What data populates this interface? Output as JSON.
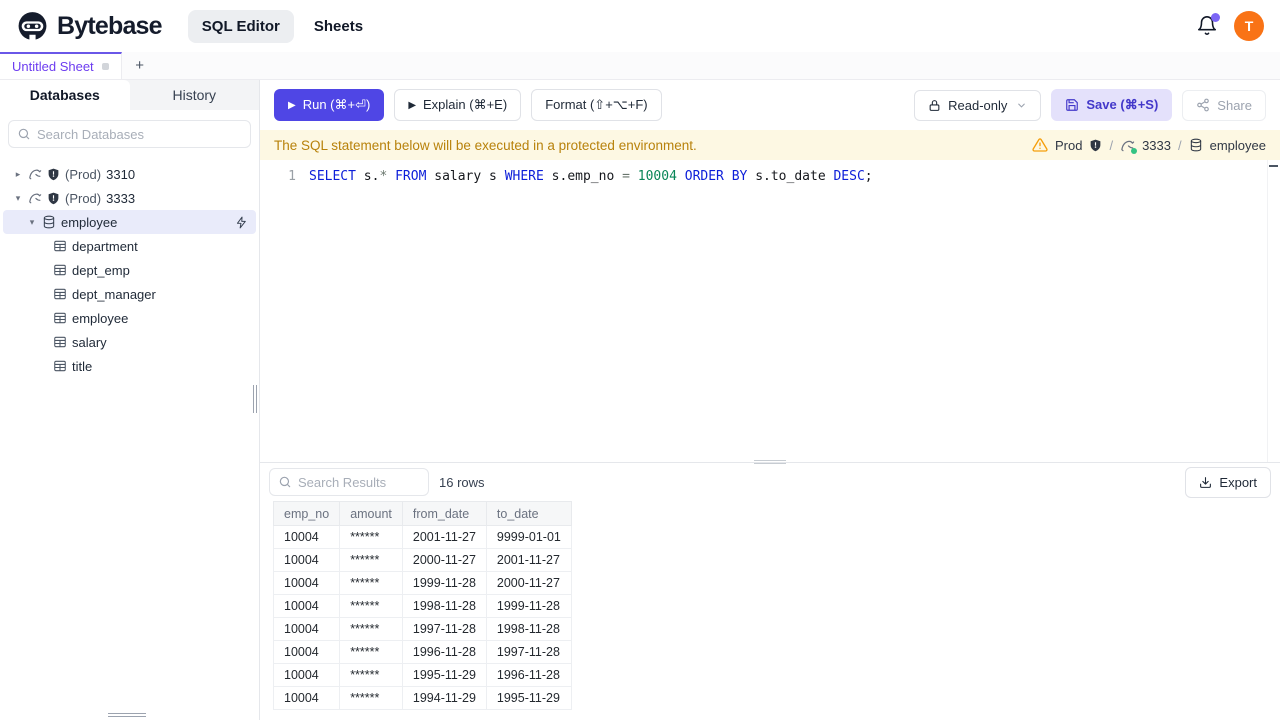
{
  "colors": {
    "accent": "#4f46e5",
    "tab_active_purple": "#6d3df0",
    "avatar_orange": "#f97316",
    "notification_dot": "#7c66f5",
    "banner_bg": "#fdf8e3",
    "banner_text": "#b8820b",
    "warning_icon": "#f59e0b",
    "selected_row_bg": "#e9ebfa",
    "sql_keyword": "#0c1ed9",
    "sql_number": "#098658",
    "mysql_status_dot": "#34c383"
  },
  "header": {
    "brand": "Bytebase",
    "nav": [
      {
        "label": "SQL Editor",
        "active": true
      },
      {
        "label": "Sheets",
        "active": false
      }
    ],
    "avatar_text": "T"
  },
  "sheet_tabs": {
    "tabs": [
      {
        "label": "Untitled Sheet",
        "active": true,
        "dirty": true
      }
    ],
    "add_label": "+"
  },
  "sidebar": {
    "tabs": [
      {
        "label": "Databases",
        "active": true
      },
      {
        "label": "History",
        "active": false
      }
    ],
    "search_placeholder": "Search Databases",
    "tree": [
      {
        "type": "instance",
        "prefix": "(Prod)",
        "name": "3310",
        "expanded": false
      },
      {
        "type": "instance",
        "prefix": "(Prod)",
        "name": "3333",
        "expanded": true
      },
      {
        "type": "database",
        "name": "employee",
        "selected": true,
        "expanded": true
      },
      {
        "type": "table",
        "name": "department"
      },
      {
        "type": "table",
        "name": "dept_emp"
      },
      {
        "type": "table",
        "name": "dept_manager"
      },
      {
        "type": "table",
        "name": "employee"
      },
      {
        "type": "table",
        "name": "salary"
      },
      {
        "type": "table",
        "name": "title"
      }
    ]
  },
  "toolbar": {
    "run": "Run (⌘+⏎)",
    "explain": "Explain (⌘+E)",
    "format": "Format (⇧+⌥+F)",
    "readonly": "Read-only",
    "save": "Save (⌘+S)",
    "share": "Share"
  },
  "banner": {
    "message": "The SQL statement below will be executed in a protected environment.",
    "environment": "Prod",
    "instance": "3333",
    "database": "employee",
    "separator": "/"
  },
  "editor": {
    "line_number": "1",
    "sql_text": "SELECT s.* FROM salary s WHERE s.emp_no = 10004 ORDER BY s.to_date DESC;",
    "tokens": [
      {
        "t": "SELECT",
        "c": "keyword"
      },
      {
        "t": " s.",
        "c": "plain"
      },
      {
        "t": "*",
        "c": "operator"
      },
      {
        "t": " ",
        "c": "plain"
      },
      {
        "t": "FROM",
        "c": "keyword"
      },
      {
        "t": " salary s ",
        "c": "plain"
      },
      {
        "t": "WHERE",
        "c": "keyword"
      },
      {
        "t": " s.emp_no ",
        "c": "plain"
      },
      {
        "t": "=",
        "c": "operator"
      },
      {
        "t": " ",
        "c": "plain"
      },
      {
        "t": "10004",
        "c": "number"
      },
      {
        "t": " ",
        "c": "plain"
      },
      {
        "t": "ORDER BY",
        "c": "keyword"
      },
      {
        "t": " s.to_date ",
        "c": "plain"
      },
      {
        "t": "DESC",
        "c": "keyword"
      },
      {
        "t": ";",
        "c": "plain"
      }
    ]
  },
  "results": {
    "search_placeholder": "Search Results",
    "row_count": "16 rows",
    "export_label": "Export",
    "table": {
      "columns": [
        "emp_no",
        "amount",
        "from_date",
        "to_date"
      ],
      "rows": [
        [
          "10004",
          "******",
          "2001-11-27",
          "9999-01-01"
        ],
        [
          "10004",
          "******",
          "2000-11-27",
          "2001-11-27"
        ],
        [
          "10004",
          "******",
          "1999-11-28",
          "2000-11-27"
        ],
        [
          "10004",
          "******",
          "1998-11-28",
          "1999-11-28"
        ],
        [
          "10004",
          "******",
          "1997-11-28",
          "1998-11-28"
        ],
        [
          "10004",
          "******",
          "1996-11-28",
          "1997-11-28"
        ],
        [
          "10004",
          "******",
          "1995-11-29",
          "1996-11-28"
        ],
        [
          "10004",
          "******",
          "1994-11-29",
          "1995-11-29"
        ]
      ]
    }
  }
}
